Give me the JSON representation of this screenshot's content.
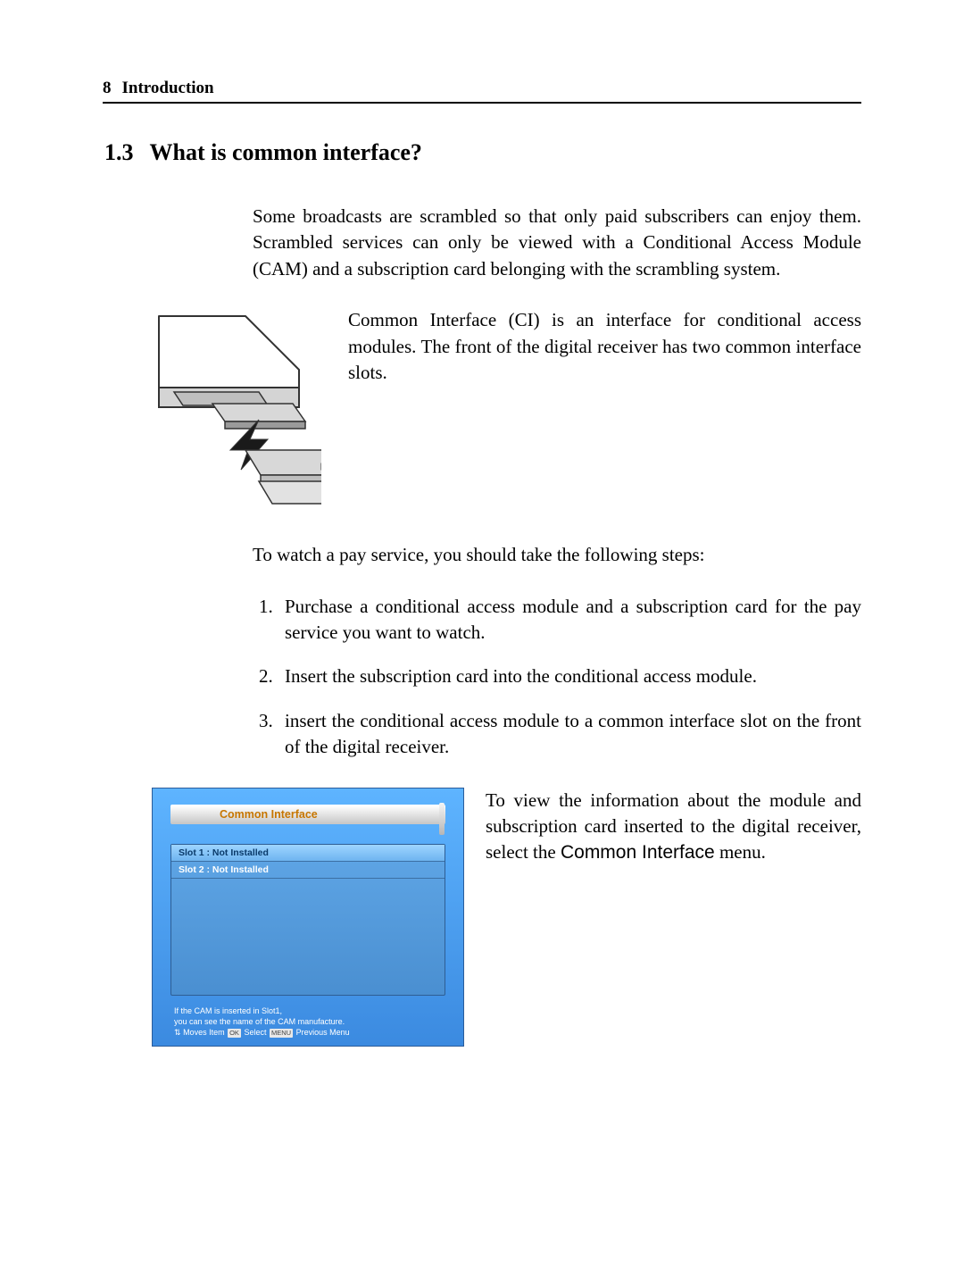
{
  "header": {
    "page": "8",
    "chapter": "Introduction"
  },
  "section": {
    "number": "1.3",
    "title": "What is common interface?"
  },
  "intro_para": "Some broadcasts are scrambled so that only paid subscribers can enjoy them. Scrambled services can only be viewed with a Conditional Access Module (CAM) and a subscription card belonging with the scrambling system.",
  "figure_para": "Common Interface (CI) is an interface for conditional access modules. The front of the digital receiver has two common interface slots.",
  "steps_intro": "To watch a pay service, you should take the following steps:",
  "steps": [
    "Purchase a conditional access module and a subscription card for the pay service you want to watch.",
    "Insert the subscription card into the conditional access module.",
    "insert the conditional access module to a common interface slot on the front of the digital receiver."
  ],
  "screenshot": {
    "title": "Common Interface",
    "slot1": "Slot 1 : Not Installed",
    "slot2": "Slot 2 : Not Installed",
    "tip1": "If the CAM is inserted in Slot1,",
    "tip2": "you can see the name of the CAM manufacture.",
    "nav_moves": "Moves Item",
    "nav_ok": "OK",
    "nav_select": "Select",
    "nav_menu": "MENU",
    "nav_prev": "Previous Menu"
  },
  "screenshot_para_before": "To view the information about the module and subscription card inserted to the digital receiver, select the ",
  "screenshot_para_sans": "Common Interface",
  "screenshot_para_after": " menu."
}
